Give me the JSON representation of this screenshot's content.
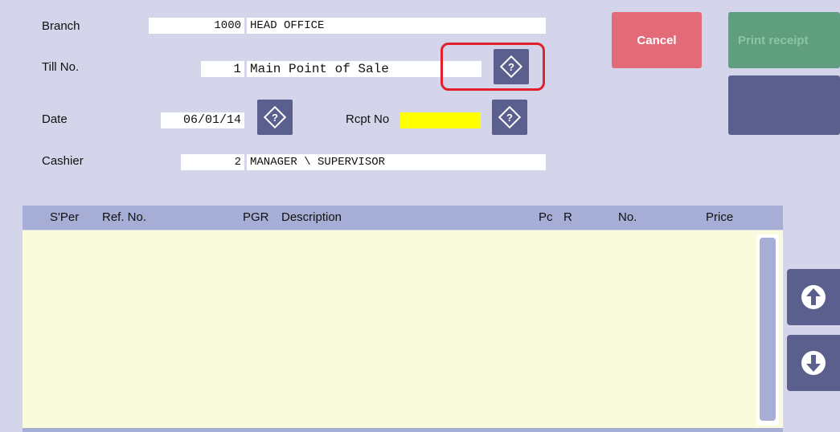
{
  "header": {
    "branch": {
      "label": "Branch",
      "code": "1000",
      "name": "HEAD OFFICE"
    },
    "till": {
      "label": "Till No.",
      "code": "1",
      "name": "Main Point of Sale"
    },
    "date": {
      "label": "Date",
      "value": "06/01/14"
    },
    "receipt": {
      "label": "Rcpt No",
      "value": ""
    },
    "cashier": {
      "label": "Cashier",
      "code": "2",
      "name": "MANAGER \\ SUPERVISOR"
    }
  },
  "buttons": {
    "cancel": "Cancel",
    "print_receipt": "Print receipt",
    "secondary": ""
  },
  "table": {
    "columns": [
      "S'Per",
      "Ref. No.",
      "PGR",
      "Description",
      "Pc",
      "R",
      "No.",
      "Price"
    ],
    "rows": []
  },
  "colors": {
    "background": "#d4d4ea",
    "cancel": "#e36b78",
    "print": "#5f9e7e",
    "button": "#5a5f8e",
    "receipt_highlight": "#ffff00",
    "grid": "#fafadc"
  },
  "icons": {
    "help": "help-diamond-icon",
    "scroll_up": "arrow-up-icon",
    "scroll_down": "arrow-down-icon"
  }
}
